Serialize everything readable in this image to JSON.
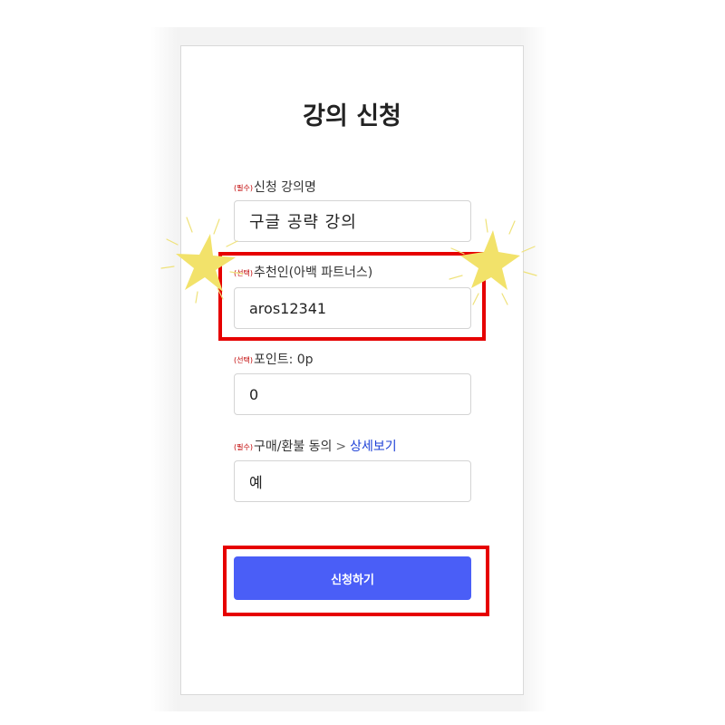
{
  "page": {
    "title": "강의 신청"
  },
  "form": {
    "fields": [
      {
        "tag": "(필수)",
        "label": "신청 강의명",
        "value": "구글 공략 강의"
      },
      {
        "tag": "(선택)",
        "label": "추천인(아백 파트너스)",
        "value": "aros12341"
      },
      {
        "tag": "(선택)",
        "label": "포인트: 0p",
        "value": "0"
      },
      {
        "tag": "(필수)",
        "label": "구매/환불 동의",
        "separator": ">",
        "link": "상세보기",
        "value": "예"
      }
    ],
    "submit_label": "신청하기"
  },
  "annotations": {
    "highlight_color": "#e60000",
    "star_color": "#f2e26a"
  },
  "theme": {
    "accent": "#4a5ef7",
    "required_tag_color": "#c00000",
    "link_color": "#1c3fd6"
  }
}
